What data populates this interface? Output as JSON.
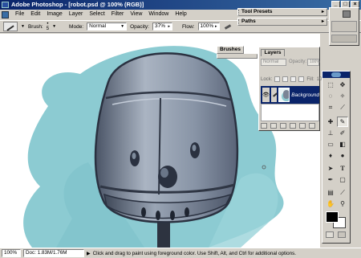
{
  "app": {
    "title": "Adobe Photoshop - [robot.psd @ 100% (RGB)]",
    "window_buttons": [
      "_",
      "□",
      "×"
    ]
  },
  "menu": {
    "items": [
      "File",
      "Edit",
      "Image",
      "Layer",
      "Select",
      "Filter",
      "View",
      "Window",
      "Help"
    ]
  },
  "options": {
    "brush_label": "Brush:",
    "brush_size": "5",
    "mode_label": "Mode:",
    "mode_value": "Normal",
    "opacity_label": "Opacity:",
    "opacity_value": "37%",
    "flow_label": "Flow:",
    "flow_value": "100%"
  },
  "palettes": {
    "tool_presets": "Tool Presets",
    "paths": "Paths",
    "brushes": "Brushes",
    "layers": {
      "tab": "Layers",
      "mode": "Normal",
      "opacity_label": "Opacity:",
      "opacity_value": "100%",
      "lock_label": "Lock:",
      "fill_label": "Fill:",
      "fill_value": "100%",
      "layer_name": "Background"
    }
  },
  "status": {
    "zoom": "100%",
    "doc": "Doc: 1.83M/1.76M",
    "hint": "Click and drag to paint using foreground color. Use Shift, Alt, and Ctrl for additional options."
  },
  "colors": {
    "title_bar": "#0a246a",
    "chrome": "#d4d0c8",
    "sky_paint": "#8ccbd2",
    "robot_metal": "#7e8b9c"
  },
  "icons": {
    "toolbox": [
      "marquee-icon",
      "move-icon",
      "lasso-icon",
      "magic-wand-icon",
      "crop-icon",
      "slice-icon",
      "healing-icon",
      "brush-icon",
      "stamp-icon",
      "history-brush-icon",
      "eraser-icon",
      "gradient-icon",
      "blur-icon",
      "dodge-icon",
      "path-select-icon",
      "type-icon",
      "pen-icon",
      "shape-icon",
      "notes-icon",
      "eyedropper-icon",
      "hand-icon",
      "zoom-icon"
    ]
  }
}
